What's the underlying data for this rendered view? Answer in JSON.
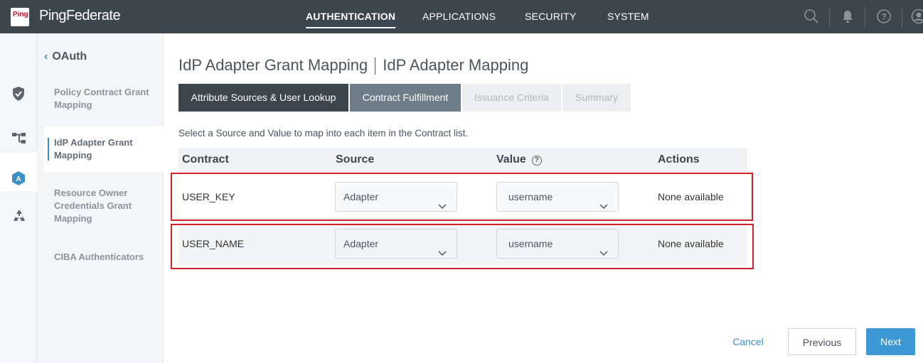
{
  "brand": {
    "logo_text": "Ping",
    "name": "PingFederate"
  },
  "topnav": {
    "items": [
      {
        "label": "AUTHENTICATION",
        "active": true
      },
      {
        "label": "APPLICATIONS",
        "active": false
      },
      {
        "label": "SECURITY",
        "active": false
      },
      {
        "label": "SYSTEM",
        "active": false
      }
    ],
    "icons": [
      "search-icon",
      "bell-icon",
      "help-circle-icon",
      "user-icon"
    ]
  },
  "rail": {
    "icons": [
      "shield-check-icon",
      "diagram-icon",
      "oauth-badge-icon",
      "recycle-icon"
    ],
    "active_index": 2
  },
  "subnav": {
    "back_label": "OAuth",
    "items": [
      {
        "label": "Policy Contract Grant Mapping",
        "active": false
      },
      {
        "label": "IdP Adapter Grant Mapping",
        "active": true
      },
      {
        "label": "Resource Owner Credentials Grant Mapping",
        "active": false
      },
      {
        "label": "CIBA Authenticators",
        "active": false
      }
    ]
  },
  "page": {
    "title": "IdP Adapter Grant Mapping",
    "subtitle": "IdP Adapter Mapping",
    "tabs": [
      {
        "label": "Attribute Sources & User Lookup",
        "state": "done"
      },
      {
        "label": "Contract Fulfillment",
        "state": "current"
      },
      {
        "label": "Issuance Criteria",
        "state": "disabled"
      },
      {
        "label": "Summary",
        "state": "disabled"
      }
    ],
    "description": "Select a Source and Value to map into each item in the Contract list."
  },
  "table": {
    "headers": {
      "contract": "Contract",
      "source": "Source",
      "value": "Value",
      "actions": "Actions"
    },
    "value_help_icon": "help-circle-icon",
    "rows": [
      {
        "contract": "USER_KEY",
        "source": "Adapter",
        "value": "username",
        "actions": "None available"
      },
      {
        "contract": "USER_NAME",
        "source": "Adapter",
        "value": "username",
        "actions": "None available"
      }
    ]
  },
  "footer": {
    "cancel": "Cancel",
    "previous": "Previous",
    "next": "Next"
  },
  "colors": {
    "topbar": "#3c464f",
    "accent": "#3d98d3",
    "highlight": "#d0202a",
    "tab_done": "#3c464f",
    "tab_current": "#6e7c88"
  }
}
